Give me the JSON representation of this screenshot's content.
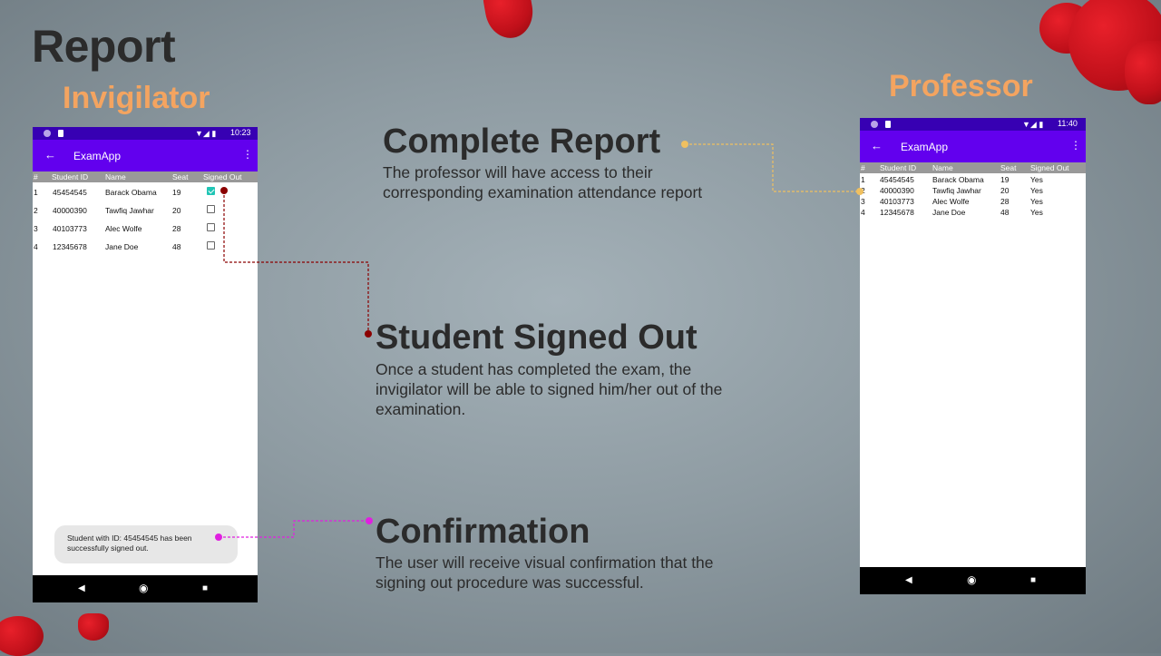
{
  "slide": {
    "title": "Report",
    "invigilator_label": "Invigilator",
    "professor_label": "Professor"
  },
  "callouts": {
    "complete_report": {
      "heading": "Complete Report",
      "line1": "The professor will have access to their",
      "line2": "corresponding examination attendance report"
    },
    "signed_out": {
      "heading": "Student Signed Out",
      "line1": "Once a student has completed the exam, the",
      "line2": "invigilator will be able to signed him/her out of the",
      "line3": "examination."
    },
    "confirmation": {
      "heading": "Confirmation",
      "line1": "The user will receive visual confirmation that the",
      "line2": "signing out procedure was successful."
    }
  },
  "invigilator_phone": {
    "time": "10:23",
    "app_title": "ExamApp",
    "back_icon": "arrow-left-icon",
    "menu_icon": "overflow-menu-icon",
    "columns": [
      "#",
      "Student ID",
      "Name",
      "Seat",
      "Signed Out"
    ],
    "rows": [
      {
        "num": "1",
        "id": "45454545",
        "name": "Barack Obama",
        "seat": "19",
        "signed_out": true
      },
      {
        "num": "2",
        "id": "40000390",
        "name": "Tawfiq Jawhar",
        "seat": "20",
        "signed_out": false
      },
      {
        "num": "3",
        "id": "40103773",
        "name": "Alec Wolfe",
        "seat": "28",
        "signed_out": false
      },
      {
        "num": "4",
        "id": "12345678",
        "name": "Jane Doe",
        "seat": "48",
        "signed_out": false
      }
    ],
    "toast_line1": "Student with ID: 45454545 has been",
    "toast_line2": "successfully signed out."
  },
  "professor_phone": {
    "time": "11:40",
    "app_title": "ExamApp",
    "back_icon": "arrow-left-icon",
    "menu_icon": "overflow-menu-icon",
    "columns": [
      "#",
      "Student ID",
      "Name",
      "Seat",
      "Signed Out"
    ],
    "rows": [
      {
        "num": "1",
        "id": "45454545",
        "name": "Barack Obama",
        "seat": "19",
        "signed_out": "Yes"
      },
      {
        "num": "2",
        "id": "40000390",
        "name": "Tawfiq Jawhar",
        "seat": "20",
        "signed_out": "Yes"
      },
      {
        "num": "3",
        "id": "40103773",
        "name": "Alec Wolfe",
        "seat": "28",
        "signed_out": "Yes"
      },
      {
        "num": "4",
        "id": "12345678",
        "name": "Jane Doe",
        "seat": "48",
        "signed_out": "Yes"
      }
    ]
  },
  "colors": {
    "accent_label": "#f4a460",
    "status_bar": "#3700b3",
    "app_bar": "#6200ee",
    "checkbox_checked": "#20c5b5",
    "connector_red": "#8b0000",
    "connector_gold": "#f0c060",
    "connector_magenta": "#e020e0"
  },
  "nav_icons": [
    "back-triangle-icon",
    "home-circle-icon",
    "recents-square-icon"
  ]
}
